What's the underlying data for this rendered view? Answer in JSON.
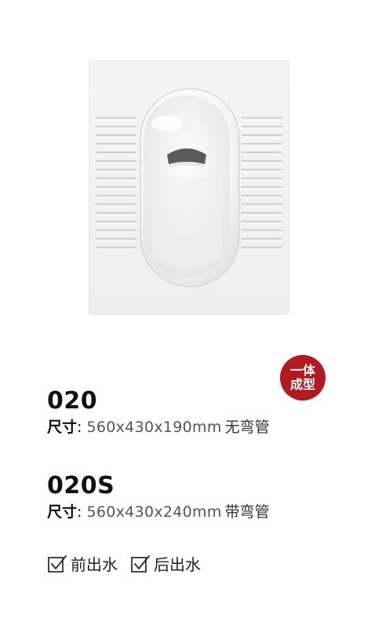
{
  "product_image": {
    "icon": "squat-toilet-pan-image"
  },
  "badge": {
    "line1": "一体",
    "line2": "成型",
    "color": "#b11b1f"
  },
  "models": [
    {
      "title": "020",
      "spec_label": "尺寸",
      "spec_colon": ": ",
      "spec_value": "560x430x190mm",
      "spec_suffix": "无弯管"
    },
    {
      "title": "020S",
      "spec_label": "尺寸",
      "spec_colon": ": ",
      "spec_value": "560x430x240mm",
      "spec_suffix": "带弯管"
    }
  ],
  "options": [
    {
      "label": "前出水",
      "icon": "checkbox-checked-icon"
    },
    {
      "label": "后出水",
      "icon": "checkbox-checked-icon"
    }
  ]
}
